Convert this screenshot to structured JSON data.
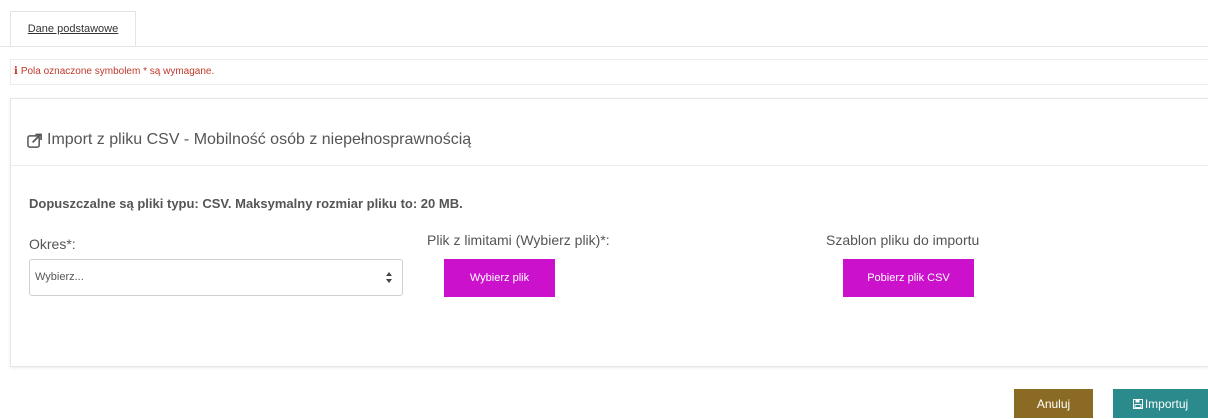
{
  "tabs": [
    {
      "label": "Dane podstawowe",
      "active": true
    }
  ],
  "required_note": {
    "icon": "info-icon",
    "icon_glyph": "i",
    "text": "Pola oznaczone symbolem * są wymagane.",
    "color": "#c0392b"
  },
  "panel": {
    "icon": "external-link-icon",
    "title": "Import z pliku CSV - Mobilność osób z niepełnosprawnością",
    "info": "Dopuszczalne są pliki typu: CSV. Maksymalny rozmiar pliku to: 20 MB.",
    "okres": {
      "label": "Okres*:",
      "selected": "Wybierz..."
    },
    "plik": {
      "label": "Plik z limitami (Wybierz plik)*:",
      "button": "Wybierz plik"
    },
    "szablon": {
      "label": "Szablon pliku do importu",
      "button": "Pobierz plik CSV"
    }
  },
  "actions": {
    "cancel": "Anuluj",
    "import": "Importuj",
    "import_icon": "floppy-disk-icon"
  },
  "colors": {
    "accent_magenta": "#cc11cc",
    "cancel_brown": "#8b6b23",
    "import_teal": "#2b8a8c",
    "required_red": "#c0392b"
  }
}
